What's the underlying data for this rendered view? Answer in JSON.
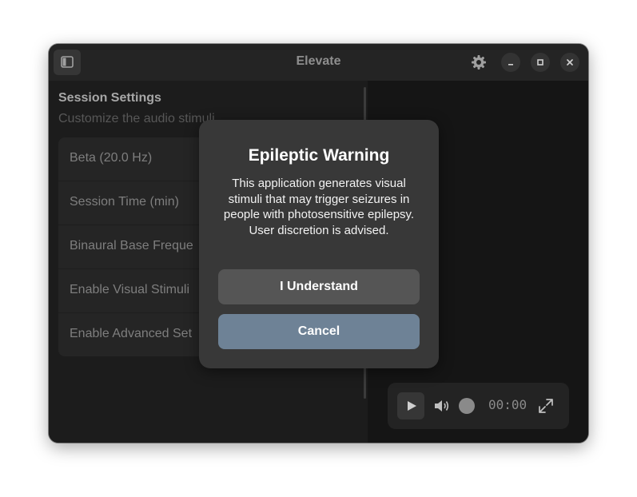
{
  "window": {
    "title": "Elevate"
  },
  "icons": {
    "sidebar_toggle": "sidebar-icon",
    "settings": "gear-icon",
    "minimize": "minimize-icon",
    "maximize": "maximize-icon",
    "close": "close-icon",
    "play": "play-icon",
    "volume": "volume-icon",
    "fullscreen": "fullscreen-icon"
  },
  "settings": {
    "title": "Session Settings",
    "subtitle": "Customize the audio stimuli",
    "rows": [
      {
        "label": "Beta (20.0 Hz)"
      },
      {
        "label": "Session Time (min)"
      },
      {
        "label": "Binaural Base Freque"
      },
      {
        "label": "Enable Visual Stimuli"
      },
      {
        "label": "Enable Advanced Set"
      }
    ]
  },
  "player": {
    "time": "00:00",
    "volume_level": 0
  },
  "dialog": {
    "title": "Epileptic Warning",
    "body": "This application generates visual stimuli that may trigger seizures in people with photosensitive epilepsy. User discretion is advised.",
    "confirm_label": "I Understand",
    "cancel_label": "Cancel"
  },
  "colors": {
    "accent": "#6e8296",
    "window_bg": "#1c1c1c",
    "dialog_bg": "#383838"
  }
}
